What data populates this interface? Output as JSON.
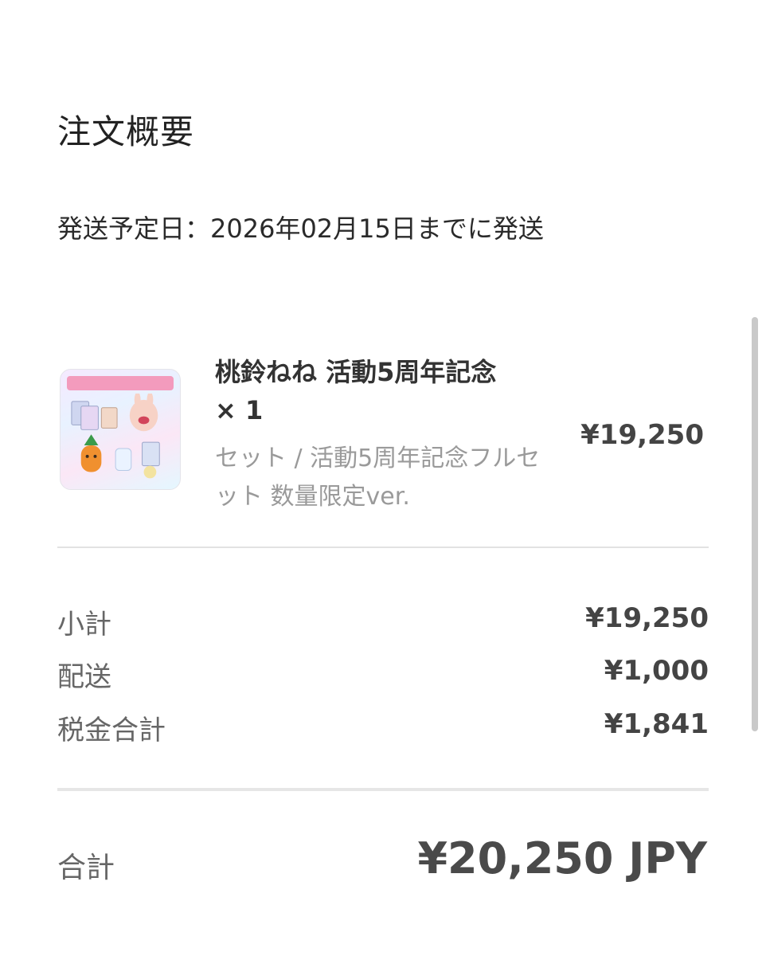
{
  "order_summary": {
    "title": "注文概要",
    "ship_date": "発送予定日：2026年02月15日までに発送"
  },
  "product": {
    "thumbnail_icon": "product-set-image",
    "name": "桃鈴ねね 活動5周年記念 × 1",
    "variant": "セット / 活動5周年記念フルセット 数量限定ver.",
    "price": "¥19,250"
  },
  "summary": {
    "subtotal_label": "小計",
    "subtotal_value": "¥19,250",
    "shipping_label": "配送",
    "shipping_value": "¥1,000",
    "tax_label": "税金合計",
    "tax_value": "¥1,841"
  },
  "total": {
    "label": "合計",
    "value": "¥20,250 JPY"
  }
}
